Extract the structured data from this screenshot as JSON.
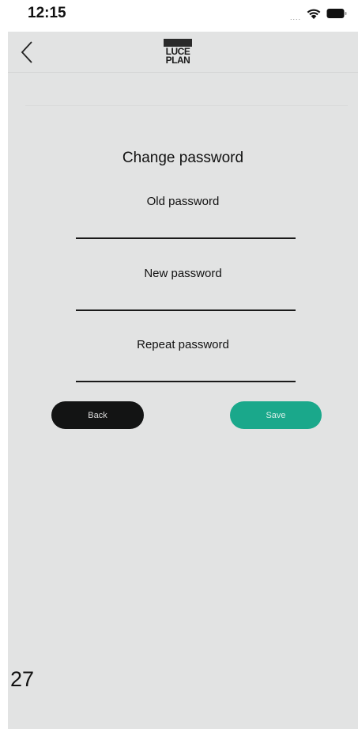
{
  "status_bar": {
    "time": "12:15",
    "signal_dots": "....",
    "icons": [
      "wifi-icon",
      "battery-icon"
    ]
  },
  "header": {
    "back_icon": "chevron-left-icon",
    "logo_line1": "LUCE",
    "logo_line2": "PLAN"
  },
  "form": {
    "title": "Change password",
    "fields": [
      {
        "label": "Old password",
        "value": ""
      },
      {
        "label": "New password",
        "value": ""
      },
      {
        "label": "Repeat password",
        "value": ""
      }
    ]
  },
  "buttons": {
    "back_label": "Back",
    "save_label": "Save"
  },
  "footer": {
    "page_number": "27"
  },
  "colors": {
    "background": "#e2e3e3",
    "save_accent": "#1aa88b",
    "back_button": "#131414"
  }
}
